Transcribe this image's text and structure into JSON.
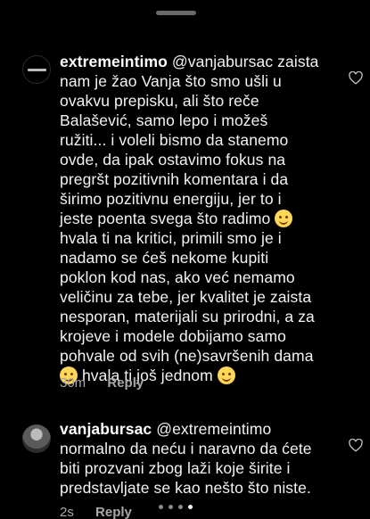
{
  "comments": [
    {
      "username": "extremeintimo",
      "lines": [
        "@vanjabursac zaista",
        "nam je žao Vanja što smo ušli u",
        "ovakvu prepisku, ali što reče",
        "Balašević, samo lepo i možeš",
        "ružiti... i voleli bismo da stanemo",
        "ovde, da ipak ostavimo fokus na",
        "pregršt pozitivnih komentara i da",
        "širimo pozitivnu energiju, jer to i",
        "jeste poenta svega što radimo",
        "hvala ti na kritici, primili smo je i",
        "nadamo se ćeš nekome kupiti",
        "poklon kod nas, ako već nemamo",
        "veličinu za tebe, jer kvalitet je zaista",
        "nesporan, materijali su prirodni, a za",
        "krojeve i modele dobijamo samo",
        "pohvale od svih (ne)savršenih dama",
        "hvala ti još jednom"
      ],
      "time": "30m",
      "reply_label": "Reply"
    },
    {
      "username": "vanjabursac",
      "lines": [
        "@extremeintimo",
        "normalno da neću i naravno da ćete",
        "biti prozvani zbog laži koje širite i",
        "predstavljate se kao nešto što niste."
      ],
      "time": "2s",
      "reply_label": "Reply"
    }
  ],
  "icons": {
    "like": "heart-outline-icon",
    "emoji": "smiling-face-emoji"
  },
  "colors": {
    "background": "#000000",
    "text": "#f2f2f2",
    "secondary": "#a8a8a8"
  }
}
